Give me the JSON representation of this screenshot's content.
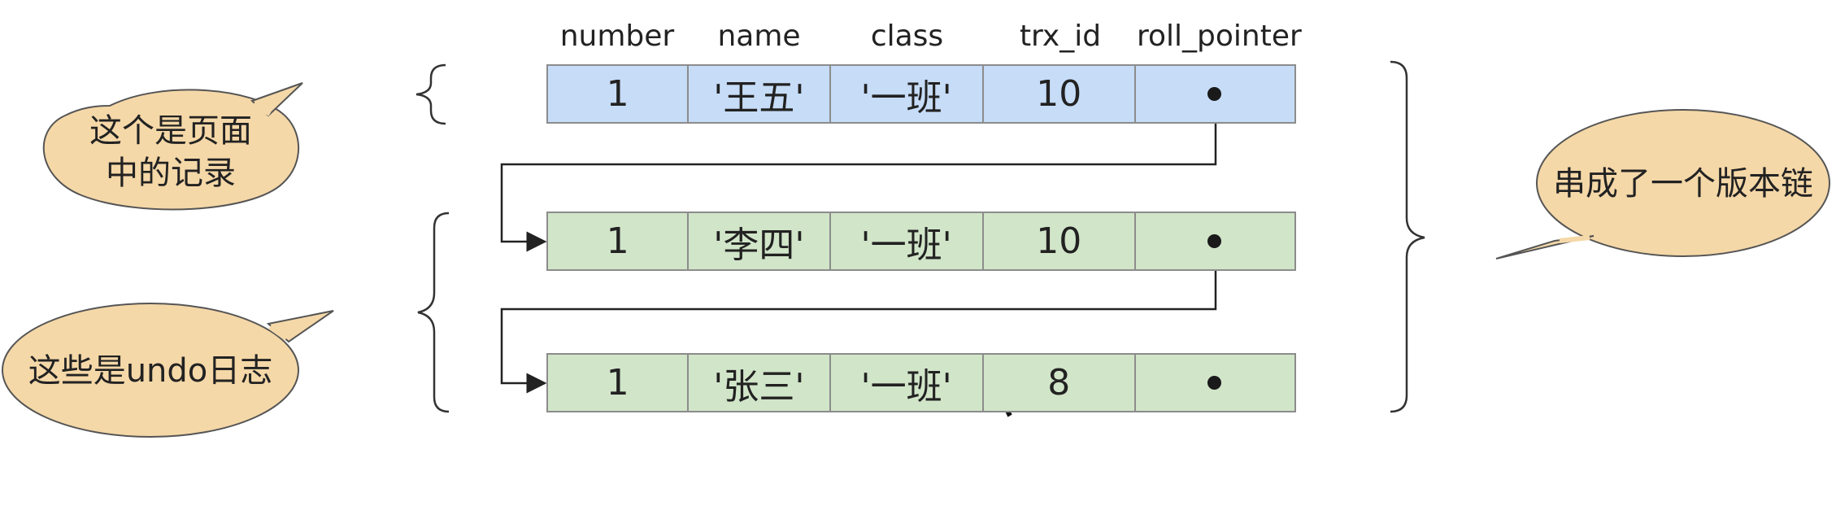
{
  "columns": [
    "number",
    "name",
    "class",
    "trx_id",
    "roll_pointer"
  ],
  "rows": [
    {
      "kind": "page",
      "values": [
        "1",
        "'王五'",
        "'一班'",
        "10",
        ""
      ]
    },
    {
      "kind": "undo",
      "values": [
        "1",
        "'李四'",
        "'一班'",
        "10",
        ""
      ]
    },
    {
      "kind": "undo",
      "values": [
        "1",
        "'张三'",
        "'一班'",
        "8",
        ""
      ]
    }
  ],
  "callouts": {
    "page_record": [
      "这个是页面",
      "中的记录"
    ],
    "undo_log": "这些是undo日志",
    "version_chain": "串成了一个版本链"
  },
  "colors": {
    "page_row": "#c6dcf7",
    "undo_row": "#d1e5c9",
    "bubble_fill": "#f5d8a8",
    "border": "#8c8c8c"
  }
}
